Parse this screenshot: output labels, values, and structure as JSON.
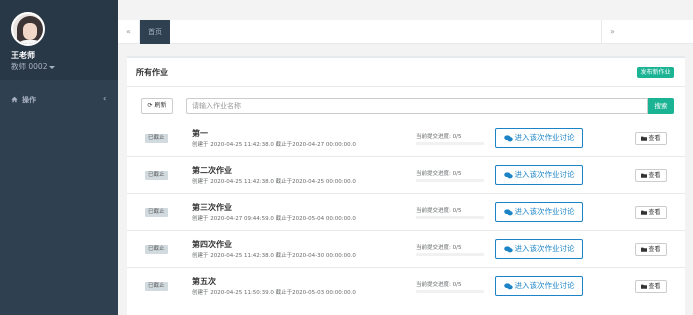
{
  "profile": {
    "name": "王老师",
    "role": "教师 0002"
  },
  "sidebar": {
    "items": [
      {
        "label": "操作",
        "icon": "home-icon"
      }
    ]
  },
  "tabs": {
    "prev_icon": "«",
    "next_icon": "»",
    "items": [
      {
        "label": "首页",
        "active": true
      }
    ]
  },
  "main": {
    "title": "所有作业",
    "publish_label": "发布新作业",
    "refresh_label": "刷新",
    "search_placeholder": "请输入作业名称",
    "search_label": "搜索",
    "homeworks": [
      {
        "status": "已截止",
        "name": "第一",
        "meta": "创建于 2020-04-25 11:42:38.0 截止于2020-04-27 00:00:00.0",
        "progress_text": "当前提交进度:  0/5",
        "progress": 0,
        "discuss_label": "进入该次作业讨论",
        "view_label": "查看"
      },
      {
        "status": "已截止",
        "name": "第二次作业",
        "meta": "创建于 2020-04-25 11:42:38.0 截止于2020-04-25 00:00:00.0",
        "progress_text": "当前提交进度:  0/5",
        "progress": 0,
        "discuss_label": "进入该次作业讨论",
        "view_label": "查看"
      },
      {
        "status": "已截止",
        "name": "第三次作业",
        "meta": "创建于 2020-04-27 09:44:59.0 截止于2020-05-04 00:00:00.0",
        "progress_text": "当前提交进度:  0/5",
        "progress": 0,
        "discuss_label": "进入该次作业讨论",
        "view_label": "查看"
      },
      {
        "status": "已截止",
        "name": "第四次作业",
        "meta": "创建于 2020-04-25 11:42:38.0 截止于2020-04-30 00:00:00.0",
        "progress_text": "当前提交进度:  0/5",
        "progress": 0,
        "discuss_label": "进入该次作业讨论",
        "view_label": "查看"
      },
      {
        "status": "已截止",
        "name": "第五次",
        "meta": "创建于 2020-04-25 11:50:39.0 截止于2020-05-03 00:00:00.0",
        "progress_text": "当前提交进度:  0/5",
        "progress": 0,
        "discuss_label": "进入该次作业讨论",
        "view_label": "查看"
      }
    ]
  },
  "colors": {
    "sidebar_bg": "#2f4050",
    "primary": "#1ab394",
    "discuss": "#1c84c6",
    "badge_bg": "#d1dade"
  }
}
